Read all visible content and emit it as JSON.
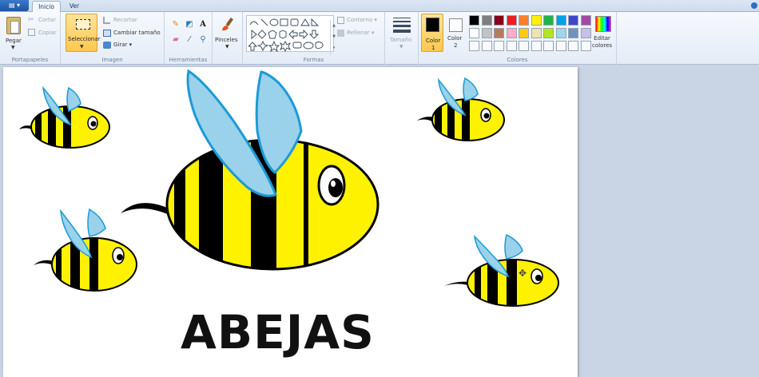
{
  "tabs": {
    "file_glyph": "▤ ▾",
    "home": "Inicio",
    "view": "Ver"
  },
  "clipboard": {
    "group_label": "Portapapeles",
    "paste": "Pegar",
    "cut": "Cortar",
    "copy": "Copiar"
  },
  "image": {
    "group_label": "Imagen",
    "select": "Seleccionar",
    "crop": "Recortar",
    "resize": "Cambiar tamaño",
    "rotate": "Girar ▾"
  },
  "tools": {
    "group_label": "Herramientas",
    "text_glyph": "A"
  },
  "brushes": {
    "label": "Pinceles"
  },
  "shapes": {
    "group_label": "Formas",
    "outline": "Contorno ▾",
    "fill": "Rellenar ▾"
  },
  "size": {
    "label": "Tamaño"
  },
  "colors": {
    "group_label": "Colores",
    "color1_label": "Color",
    "color1_num": "1",
    "color2_label": "Color",
    "color2_num": "2",
    "edit_label_1": "Editar",
    "edit_label_2": "colores",
    "color1_value": "#000000",
    "color2_value": "#ffffff",
    "palette": [
      "#000000",
      "#7f7f7f",
      "#880015",
      "#ed1c24",
      "#ff7f27",
      "#fff200",
      "#22b14c",
      "#00a2e8",
      "#3f48cc",
      "#a349a4",
      "#ffffff",
      "#c3c3c3",
      "#b97a57",
      "#ffaec9",
      "#ffc90e",
      "#efe4b0",
      "#b5e61d",
      "#99d9ea",
      "#7092be",
      "#c8bfe7"
    ]
  },
  "canvas": {
    "title": "ABEJAS",
    "bee_body": "#fff200",
    "bee_stripe": "#000000",
    "bee_wing": "#99d2ea",
    "bee_wing_outline": "#1c9ad6"
  }
}
